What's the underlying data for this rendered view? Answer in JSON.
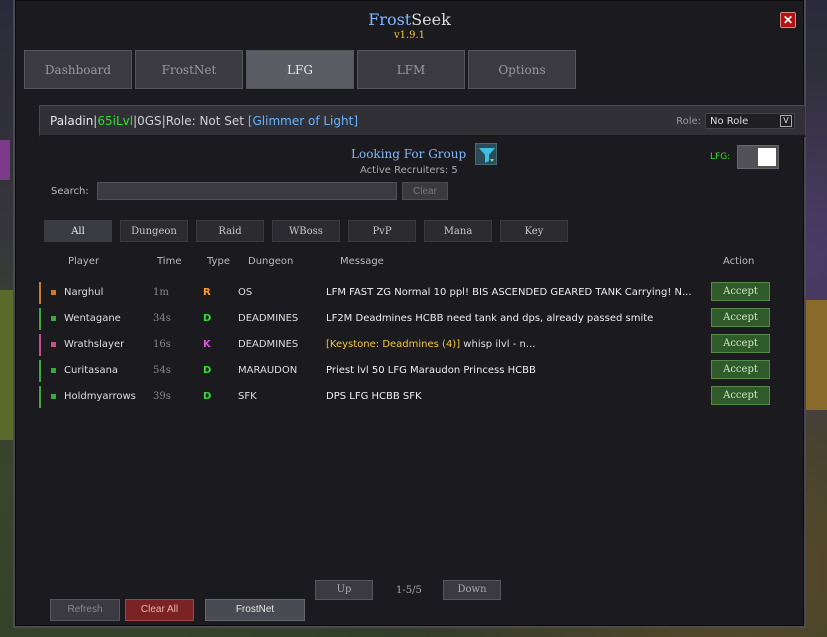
{
  "window": {
    "title_part1": "Frost",
    "title_part2": "Seek",
    "version": "v1.9.1",
    "close_glyph": "✕"
  },
  "tabs": [
    {
      "label": "Dashboard",
      "active": false
    },
    {
      "label": "FrostNet",
      "active": false
    },
    {
      "label": "LFG",
      "active": true
    },
    {
      "label": "LFM",
      "active": false
    },
    {
      "label": "Options",
      "active": false
    }
  ],
  "player_info": {
    "class": "Paladin",
    "sep1": " | ",
    "ilvl": "65iLvl",
    "sep2": " | ",
    "gs": "0GS",
    "sep3": " | ",
    "role_text": "Role: Not Set",
    "spell": "[Glimmer of Light]",
    "role_label": "Role:",
    "role_value": "No Role",
    "role_chevron": "V"
  },
  "lfg": {
    "heading": "Looking For Group",
    "recruiters": "Active Recruiters: 5",
    "toggle_label": "LFG:"
  },
  "search": {
    "label": "Search:",
    "value": "",
    "clear_label": "Clear"
  },
  "categories": [
    "All",
    "Dungeon",
    "Raid",
    "WBoss",
    "PvP",
    "Mana",
    "Key"
  ],
  "columns": {
    "player": "Player",
    "time": "Time",
    "type": "Type",
    "dungeon": "Dungeon",
    "message": "Message",
    "action": "Action"
  },
  "rows": [
    {
      "player": "Narghul",
      "time": "1m",
      "type": "R",
      "dungeon": "OS",
      "message": "LFM FAST ZG Normal 10 ppl! BIS ASCENDED GEARED TANK Carrying! N...",
      "message_rest": "",
      "action": "Accept",
      "class_color": "#c97a2a",
      "type_color": "#ff9a2a",
      "key": false
    },
    {
      "player": "Wentagane",
      "time": "34s",
      "type": "D",
      "dungeon": "DEADMINES",
      "message": "LF2M Deadmines HCBB need tank and dps, already passed smite",
      "message_rest": "",
      "action": "Accept",
      "class_color": "#3ca83c",
      "type_color": "#33dd33",
      "key": false
    },
    {
      "player": "Wrathslayer",
      "time": "16s",
      "type": "K",
      "dungeon": "DEADMINES",
      "message": " [Keystone: Deadmines (4)]",
      "message_rest": " whisp ilvl - n...",
      "action": "Accept",
      "class_color": "#c44f8a",
      "type_color": "#e04fe0",
      "key": true
    },
    {
      "player": "Curitasana",
      "time": "54s",
      "type": "D",
      "dungeon": "MARAUDON",
      "message": "Priest lvl 50 LFG Maraudon Princess HCBB",
      "message_rest": "",
      "action": "Accept",
      "class_color": "#3ca83c",
      "type_color": "#33dd33",
      "key": false
    },
    {
      "player": "Holdmyarrows",
      "time": "39s",
      "type": "D",
      "dungeon": "SFK",
      "message": "DPS LFG HCBB SFK",
      "message_rest": "",
      "action": "Accept",
      "class_color": "#3ca83c",
      "type_color": "#33dd33",
      "key": false
    }
  ],
  "pager": {
    "up": "Up",
    "count": "1-5/5",
    "down": "Down"
  },
  "bottom": {
    "refresh": "Refresh",
    "clear_all": "Clear All",
    "frostnet": "FrostNet"
  }
}
